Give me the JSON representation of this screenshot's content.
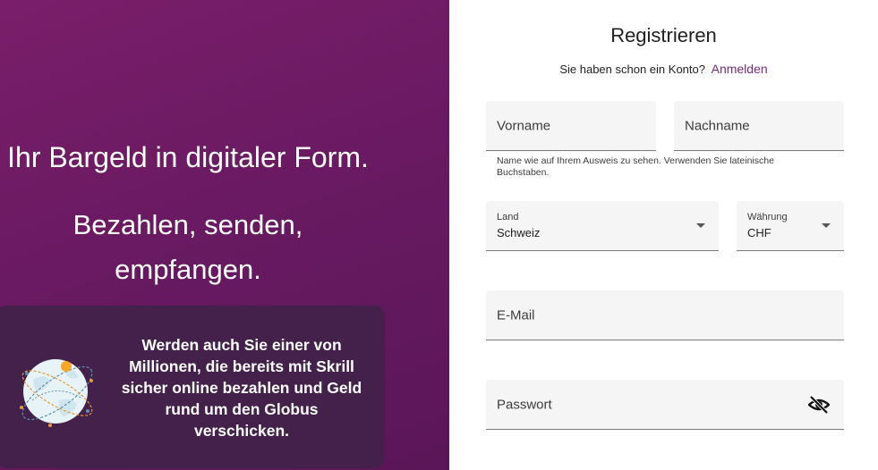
{
  "hero": {
    "headline": "Ihr Bargeld in digitaler Form.",
    "subline": "Bezahlen, senden, empfangen."
  },
  "promo": {
    "text": "Werden auch Sie einer von Millionen, die bereits mit Skrill sicher online bezahlen und Geld rund um den Globus verschicken.",
    "icon": "globe-icon"
  },
  "form": {
    "title": "Registrieren",
    "login_prompt": "Sie haben schon ein Konto?",
    "login_link": "Anmelden",
    "first_name_placeholder": "Vorname",
    "last_name_placeholder": "Nachname",
    "name_helper": "Name wie auf Ihrem Ausweis zu sehen. Verwenden Sie lateinische Buchstaben.",
    "country_label": "Land",
    "country_value": "Schweiz",
    "currency_label": "Währung",
    "currency_value": "CHF",
    "email_placeholder": "E-Mail",
    "password_placeholder": "Passwort",
    "password_toggle_icon": "eye-off-icon"
  },
  "colors": {
    "brand_purple": "#6a1a62",
    "promo_card": "#43214a",
    "link": "#7b2a7a",
    "field_bg": "#f5f5f5"
  }
}
